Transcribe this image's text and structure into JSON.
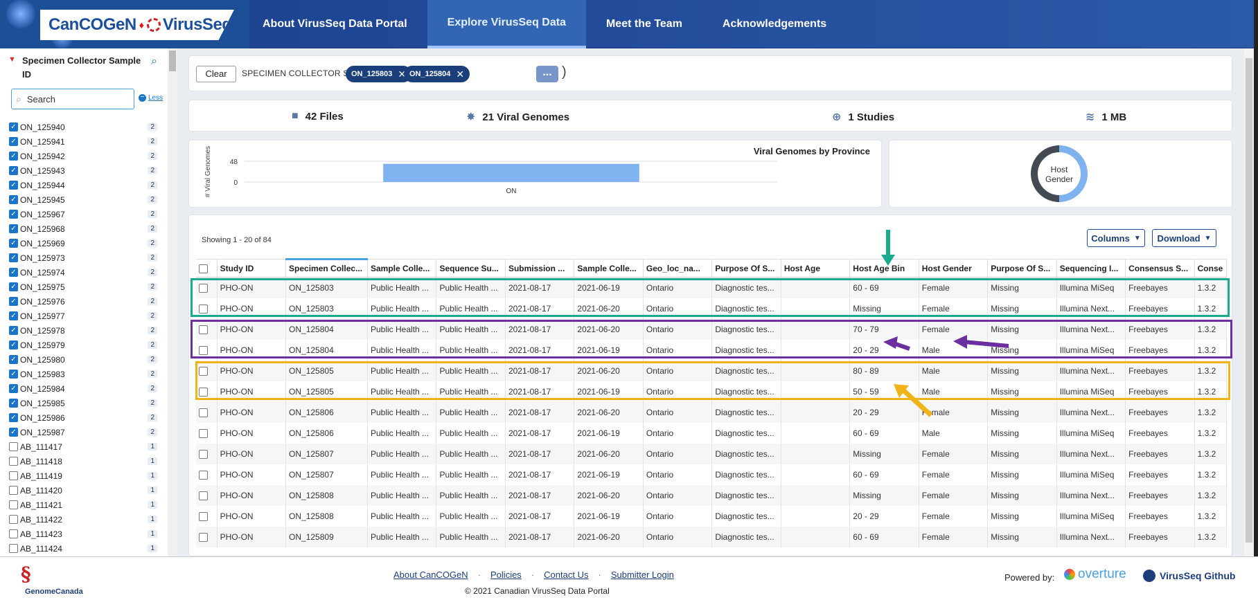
{
  "brand": {
    "name": "CanCOGeN",
    "product": "VirusSeq"
  },
  "nav": [
    {
      "label": "About VirusSeq Data Portal",
      "active": false
    },
    {
      "label": "Explore VirusSeq Data",
      "active": true
    },
    {
      "label": "Meet the Team",
      "active": false
    },
    {
      "label": "Acknowledgements",
      "active": false
    }
  ],
  "sidebar": {
    "facet_title": "Specimen Collector Sample ID",
    "search_placeholder": "Search",
    "less_label": "Less",
    "items": [
      {
        "label": "ON_125940",
        "count": "2",
        "checked": true
      },
      {
        "label": "ON_125941",
        "count": "2",
        "checked": true
      },
      {
        "label": "ON_125942",
        "count": "2",
        "checked": true
      },
      {
        "label": "ON_125943",
        "count": "2",
        "checked": true
      },
      {
        "label": "ON_125944",
        "count": "2",
        "checked": true
      },
      {
        "label": "ON_125945",
        "count": "2",
        "checked": true
      },
      {
        "label": "ON_125967",
        "count": "2",
        "checked": true
      },
      {
        "label": "ON_125968",
        "count": "2",
        "checked": true
      },
      {
        "label": "ON_125969",
        "count": "2",
        "checked": true
      },
      {
        "label": "ON_125973",
        "count": "2",
        "checked": true
      },
      {
        "label": "ON_125974",
        "count": "2",
        "checked": true
      },
      {
        "label": "ON_125975",
        "count": "2",
        "checked": true
      },
      {
        "label": "ON_125976",
        "count": "2",
        "checked": true
      },
      {
        "label": "ON_125977",
        "count": "2",
        "checked": true
      },
      {
        "label": "ON_125978",
        "count": "2",
        "checked": true
      },
      {
        "label": "ON_125979",
        "count": "2",
        "checked": true
      },
      {
        "label": "ON_125980",
        "count": "2",
        "checked": true
      },
      {
        "label": "ON_125983",
        "count": "2",
        "checked": true
      },
      {
        "label": "ON_125984",
        "count": "2",
        "checked": true
      },
      {
        "label": "ON_125985",
        "count": "2",
        "checked": true
      },
      {
        "label": "ON_125986",
        "count": "2",
        "checked": true
      },
      {
        "label": "ON_125987",
        "count": "2",
        "checked": true
      },
      {
        "label": "AB_111417",
        "count": "1",
        "checked": false
      },
      {
        "label": "AB_111418",
        "count": "1",
        "checked": false
      },
      {
        "label": "AB_111419",
        "count": "1",
        "checked": false
      },
      {
        "label": "AB_111420",
        "count": "1",
        "checked": false
      },
      {
        "label": "AB_111421",
        "count": "1",
        "checked": false
      },
      {
        "label": "AB_111422",
        "count": "1",
        "checked": false
      },
      {
        "label": "AB_111423",
        "count": "1",
        "checked": false
      },
      {
        "label": "AB_111424",
        "count": "1",
        "checked": false
      }
    ]
  },
  "sqon": {
    "clear_label": "Clear",
    "field": "SPECIMEN COLLECTOR SAMPLE ID",
    "op": "in",
    "values": [
      "ON_125803",
      "ON_125804"
    ],
    "more_label": "..."
  },
  "stats": {
    "files": "42 Files",
    "genomes": "21 Viral Genomes",
    "studies": "1 Studies",
    "size": "1 MB"
  },
  "chart_data": [
    {
      "type": "bar",
      "title": "Viral Genomes by Province",
      "ylabel": "# Viral Genomes",
      "categories": [
        "ON"
      ],
      "values": [
        42
      ],
      "yticks": [
        "48",
        "0"
      ],
      "ylim": [
        0,
        48
      ]
    },
    {
      "type": "pie",
      "title": "Host Gender",
      "labels": [
        "",
        ""
      ],
      "values": [
        50,
        50
      ],
      "colors": [
        "#7fb3f0",
        "#444a52"
      ]
    }
  ],
  "table": {
    "showing": "Showing 1 - 20 of 84",
    "columns_label": "Columns",
    "download_label": "Download",
    "headers": [
      "Study ID",
      "Specimen Collec...",
      "Sample Colle...",
      "Sequence Su...",
      "Submission ...",
      "Sample Colle...",
      "Geo_loc_na...",
      "Purpose Of S...",
      "Host Age",
      "Host Age Bin",
      "Host Gender",
      "Purpose Of S...",
      "Sequencing I...",
      "Consensus S...",
      "Conse"
    ],
    "rows": [
      [
        "PHO-ON",
        "ON_125803",
        "Public Health ...",
        "Public Health ...",
        "2021-08-17",
        "2021-06-19",
        "Ontario",
        "Diagnostic tes...",
        "",
        "60 - 69",
        "Female",
        "Missing",
        "Illumina MiSeq",
        "Freebayes",
        "1.3.2"
      ],
      [
        "PHO-ON",
        "ON_125803",
        "Public Health ...",
        "Public Health ...",
        "2021-08-17",
        "2021-06-20",
        "Ontario",
        "Diagnostic tes...",
        "",
        "Missing",
        "Female",
        "Missing",
        "Illumina Next...",
        "Freebayes",
        "1.3.2"
      ],
      [
        "PHO-ON",
        "ON_125804",
        "Public Health ...",
        "Public Health ...",
        "2021-08-17",
        "2021-06-20",
        "Ontario",
        "Diagnostic tes...",
        "",
        "70 - 79",
        "Female",
        "Missing",
        "Illumina Next...",
        "Freebayes",
        "1.3.2"
      ],
      [
        "PHO-ON",
        "ON_125804",
        "Public Health ...",
        "Public Health ...",
        "2021-08-17",
        "2021-06-19",
        "Ontario",
        "Diagnostic tes...",
        "",
        "20 - 29",
        "Male",
        "Missing",
        "Illumina MiSeq",
        "Freebayes",
        "1.3.2"
      ],
      [
        "PHO-ON",
        "ON_125805",
        "Public Health ...",
        "Public Health ...",
        "2021-08-17",
        "2021-06-20",
        "Ontario",
        "Diagnostic tes...",
        "",
        "80 - 89",
        "Male",
        "Missing",
        "Illumina Next...",
        "Freebayes",
        "1.3.2"
      ],
      [
        "PHO-ON",
        "ON_125805",
        "Public Health ...",
        "Public Health ...",
        "2021-08-17",
        "2021-06-19",
        "Ontario",
        "Diagnostic tes...",
        "",
        "50 - 59",
        "Male",
        "Missing",
        "Illumina MiSeq",
        "Freebayes",
        "1.3.2"
      ],
      [
        "PHO-ON",
        "ON_125806",
        "Public Health ...",
        "Public Health ...",
        "2021-08-17",
        "2021-06-20",
        "Ontario",
        "Diagnostic tes...",
        "",
        "20 - 29",
        "Female",
        "Missing",
        "Illumina Next...",
        "Freebayes",
        "1.3.2"
      ],
      [
        "PHO-ON",
        "ON_125806",
        "Public Health ...",
        "Public Health ...",
        "2021-08-17",
        "2021-06-19",
        "Ontario",
        "Diagnostic tes...",
        "",
        "60 - 69",
        "Male",
        "Missing",
        "Illumina MiSeq",
        "Freebayes",
        "1.3.2"
      ],
      [
        "PHO-ON",
        "ON_125807",
        "Public Health ...",
        "Public Health ...",
        "2021-08-17",
        "2021-06-20",
        "Ontario",
        "Diagnostic tes...",
        "",
        "Missing",
        "Female",
        "Missing",
        "Illumina Next...",
        "Freebayes",
        "1.3.2"
      ],
      [
        "PHO-ON",
        "ON_125807",
        "Public Health ...",
        "Public Health ...",
        "2021-08-17",
        "2021-06-19",
        "Ontario",
        "Diagnostic tes...",
        "",
        "60 - 69",
        "Female",
        "Missing",
        "Illumina MiSeq",
        "Freebayes",
        "1.3.2"
      ],
      [
        "PHO-ON",
        "ON_125808",
        "Public Health ...",
        "Public Health ...",
        "2021-08-17",
        "2021-06-20",
        "Ontario",
        "Diagnostic tes...",
        "",
        "Missing",
        "Female",
        "Missing",
        "Illumina Next...",
        "Freebayes",
        "1.3.2"
      ],
      [
        "PHO-ON",
        "ON_125808",
        "Public Health ...",
        "Public Health ...",
        "2021-08-17",
        "2021-06-19",
        "Ontario",
        "Diagnostic tes...",
        "",
        "20 - 29",
        "Female",
        "Missing",
        "Illumina MiSeq",
        "Freebayes",
        "1.3.2"
      ],
      [
        "PHO-ON",
        "ON_125809",
        "Public Health ...",
        "Public Health ...",
        "2021-08-17",
        "2021-06-20",
        "Ontario",
        "Diagnostic tes...",
        "",
        "60 - 69",
        "Female",
        "Missing",
        "Illumina Next...",
        "Freebayes",
        "1.3.2"
      ]
    ]
  },
  "annotations": {
    "colors": {
      "teal": "#1aaa8e",
      "purple": "#6b2fa0",
      "gold": "#f0b418"
    }
  },
  "footer": {
    "links": [
      "About CanCOGeN",
      "Policies",
      "Contact Us",
      "Submitter Login"
    ],
    "copyright": "© 2021 Canadian VirusSeq Data Portal",
    "genome_canada": "GenomeCanada",
    "powered_by": "Powered by:",
    "overture": "overture",
    "github": "VirusSeq Github"
  }
}
